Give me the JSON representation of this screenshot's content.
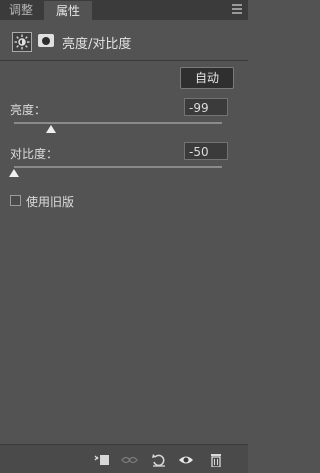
{
  "tabs": [
    {
      "label": "调整"
    },
    {
      "label": "属性"
    }
  ],
  "header": {
    "title": "亮度/对比度"
  },
  "auto_button": "自动",
  "brightness": {
    "label": "亮度：",
    "value": "-99",
    "slider_fraction": 0.18
  },
  "contrast": {
    "label": "对比度：",
    "value": "-50",
    "slider_fraction": 0.0
  },
  "legacy": {
    "label": "使用旧版",
    "checked": false
  },
  "icons": {
    "adjustment": "brightness-sun-icon",
    "mask": "layer-mask-icon",
    "panel_menu": "hamburger-icon",
    "clip": "clip-to-layer-icon",
    "prev_state": "view-previous-state-icon",
    "reset": "reset-icon",
    "visibility": "eye-icon",
    "delete": "trash-icon"
  }
}
